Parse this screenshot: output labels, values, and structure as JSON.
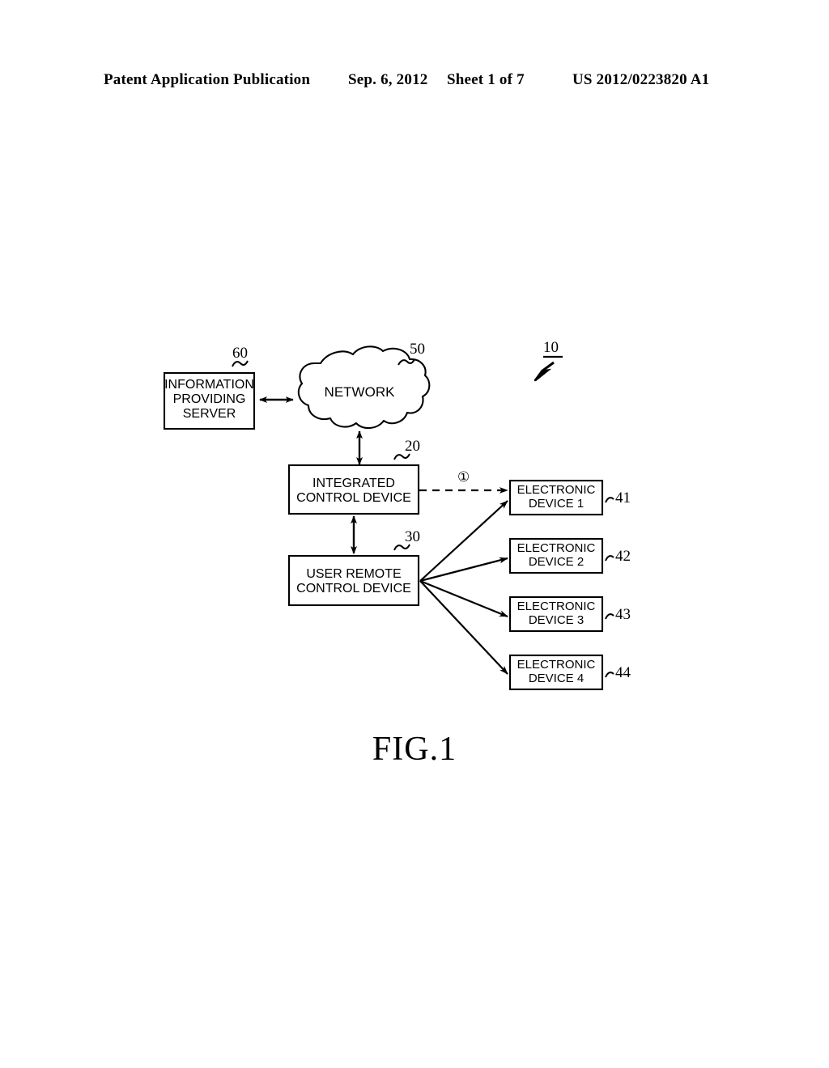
{
  "header": {
    "publication_type": "Patent Application Publication",
    "date": "Sep. 6, 2012",
    "sheet": "Sheet 1 of 7",
    "publication_number": "US 2012/0223820 A1"
  },
  "figure": {
    "caption": "FIG.1",
    "system_ref": "10",
    "nodes": {
      "server": {
        "label": "INFORMATION\nPROVIDING\nSERVER",
        "ref": "60"
      },
      "network": {
        "label": "NETWORK",
        "ref": "50"
      },
      "integrated_control": {
        "label": "INTEGRATED\nCONTROL DEVICE",
        "ref": "20"
      },
      "user_remote_control": {
        "label": "USER REMOTE\nCONTROL DEVICE",
        "ref": "30"
      },
      "device1": {
        "label": "ELECTRONIC\nDEVICE 1",
        "ref": "41"
      },
      "device2": {
        "label": "ELECTRONIC\nDEVICE 2",
        "ref": "42"
      },
      "device3": {
        "label": "ELECTRONIC\nDEVICE 3",
        "ref": "43"
      },
      "device4": {
        "label": "ELECTRONIC\nDEVICE 4",
        "ref": "44"
      }
    },
    "annotations": {
      "signal_one": "①"
    },
    "colors": {
      "ink": "#000000",
      "paper": "#ffffff"
    }
  }
}
